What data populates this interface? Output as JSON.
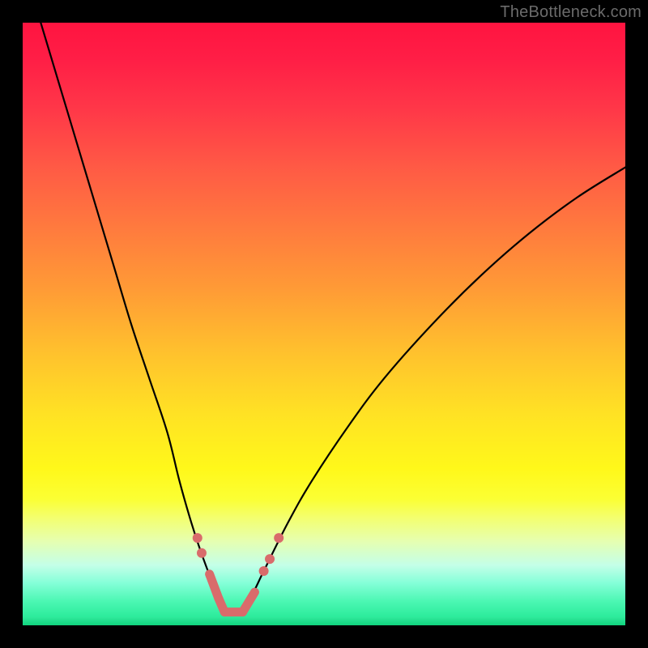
{
  "watermark": {
    "text": "TheBottleneck.com"
  },
  "chart_data": {
    "type": "line",
    "title": "",
    "xlabel": "",
    "ylabel": "",
    "xlim": [
      0,
      100
    ],
    "ylim": [
      0,
      100
    ],
    "grid": false,
    "legend": false,
    "optimum_x": 35,
    "series": [
      {
        "name": "bottleneck-curve",
        "x": [
          3,
          6,
          9,
          12,
          15,
          18,
          21,
          24,
          26,
          28,
          30,
          32,
          34,
          35,
          36,
          38,
          40,
          44,
          48,
          54,
          60,
          68,
          76,
          84,
          92,
          100
        ],
        "values": [
          100,
          90,
          80,
          70,
          60,
          50,
          41,
          32,
          24,
          17,
          11,
          6,
          2.5,
          1.8,
          2.5,
          5,
          9,
          17,
          24,
          33,
          41,
          50,
          58,
          65,
          71,
          76
        ]
      }
    ],
    "markers": [
      {
        "name": "left-marker-1",
        "x": 29.0,
        "y": 14.5
      },
      {
        "name": "left-marker-2",
        "x": 29.7,
        "y": 12.0
      },
      {
        "name": "left-segment-top",
        "x": 31.0,
        "y": 8.5
      },
      {
        "name": "left-segment-bot",
        "x": 32.5,
        "y": 4.5
      },
      {
        "name": "bottom-span-a",
        "x": 33.5,
        "y": 2.2
      },
      {
        "name": "bottom-span-b",
        "x": 36.5,
        "y": 2.2
      },
      {
        "name": "right-segment-bot",
        "x": 38.5,
        "y": 5.5
      },
      {
        "name": "right-marker-1",
        "x": 40.0,
        "y": 9.0
      },
      {
        "name": "right-marker-2",
        "x": 41.0,
        "y": 11.0
      },
      {
        "name": "right-marker-3",
        "x": 42.5,
        "y": 14.5
      }
    ],
    "colors": {
      "curve": "#000000",
      "marker": "#d96b6b",
      "gradient_top": "#ff1440",
      "gradient_bottom": "#10d47e"
    }
  }
}
